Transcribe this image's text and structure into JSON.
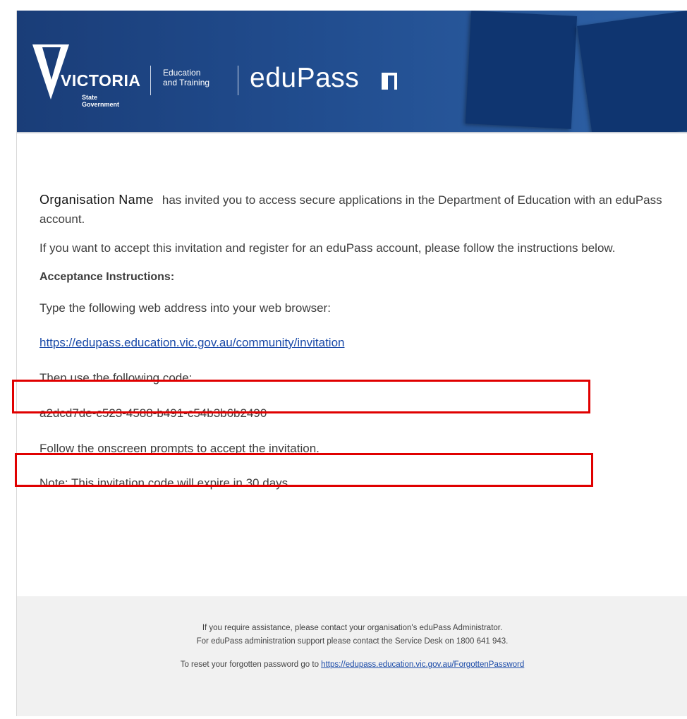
{
  "header": {
    "brand_name": "VICTORIA",
    "brand_sub_1": "State",
    "brand_sub_2": "Government",
    "department_line_1": "Education",
    "department_line_2": "and Training",
    "product_name": "eduPass"
  },
  "body": {
    "organisation_name": "Organisation Name",
    "intro_text": "has invited you to access secure applications in the Department of Education with an eduPass account.",
    "accept_text": "If you want to accept this invitation and register for an eduPass account, please follow the instructions below.",
    "instructions_heading": "Acceptance Instructions:",
    "type_address_text": "Type the following web address into your web browser:",
    "invitation_url": "https://edupass.education.vic.gov.au/community/invitation",
    "use_code_text": "Then use the following code:",
    "invitation_code": "a2dcd7de-c523-4588-b491-c54b3b6b2490",
    "follow_prompts_text": "Follow the onscreen prompts to accept the invitation.",
    "expiry_note": "Note: This invitation code will expire in 30 days."
  },
  "footer": {
    "assistance_text": "If you require assistance, please contact your organisation's eduPass Administrator.",
    "service_desk_text": "For eduPass administration support please contact the Service Desk on 1800 641 943.",
    "reset_text": "To reset your forgotten password go to",
    "reset_url": "https://edupass.education.vic.gov.au/ForgottenPassword"
  },
  "colors": {
    "header_blue": "#1a3d78",
    "highlight_red": "#e00000",
    "link_blue": "#1a4aa8",
    "footer_grey": "#f1f1f1"
  }
}
